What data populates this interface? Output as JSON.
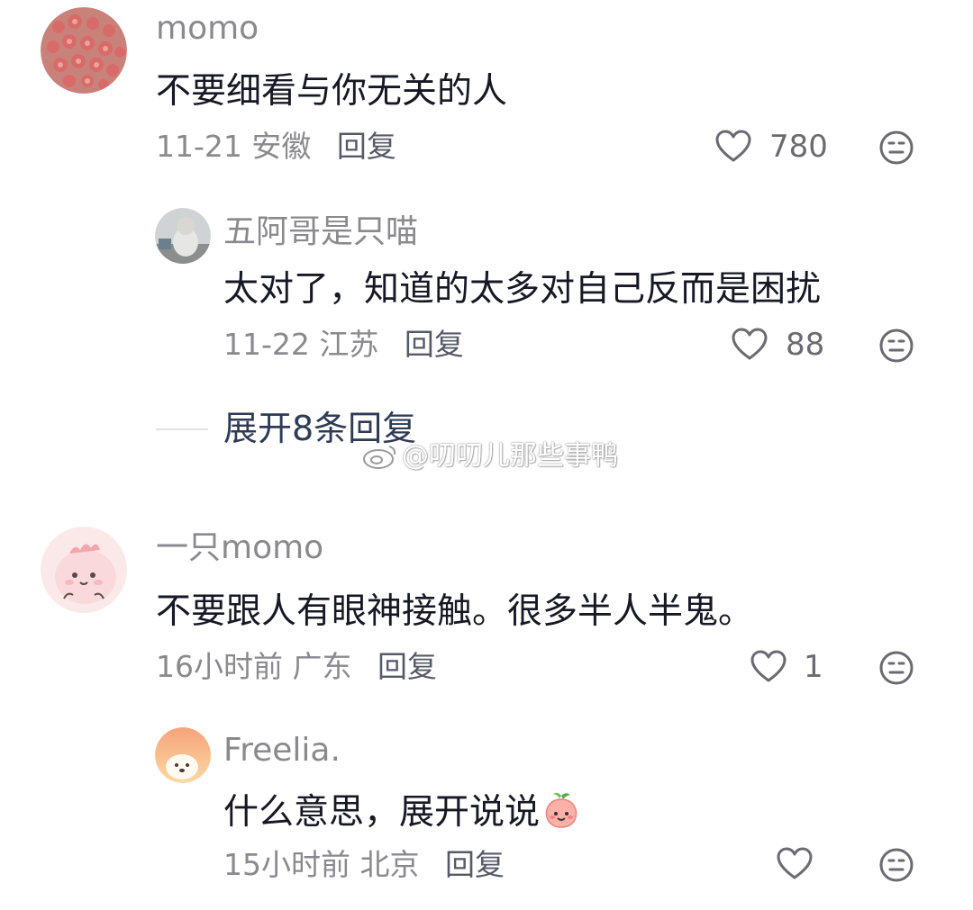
{
  "comments": [
    {
      "username": "momo",
      "text": "不要细看与你无关的人",
      "date": "11-21",
      "location": "安徽",
      "reply_label": "回复",
      "likes": "780"
    },
    {
      "username": "五阿哥是只喵",
      "text": "太对了，知道的太多对自己反而是困扰",
      "date": "11-22",
      "location": "江苏",
      "reply_label": "回复",
      "likes": "88"
    },
    {
      "username": "一只momo",
      "text": "不要跟人有眼神接触。很多半人半鬼。",
      "date": "16小时前",
      "location": "广东",
      "reply_label": "回复",
      "likes": "1"
    },
    {
      "username": "Freelia.",
      "text": "什么意思，展开说说",
      "date": "15小时前",
      "location": "北京",
      "reply_label": "回复",
      "likes": ""
    }
  ],
  "expand_replies_label": "展开8条回复",
  "watermark": "@叨叨儿那些事鸭",
  "icons": {
    "like": "heart-outline-icon",
    "more": "neutral-face-icon",
    "emoji": "peach-emoji-icon"
  },
  "colors": {
    "meta_text": "#8a8a8e",
    "body_text": "#161823",
    "expand_text": "#2f3a55"
  }
}
